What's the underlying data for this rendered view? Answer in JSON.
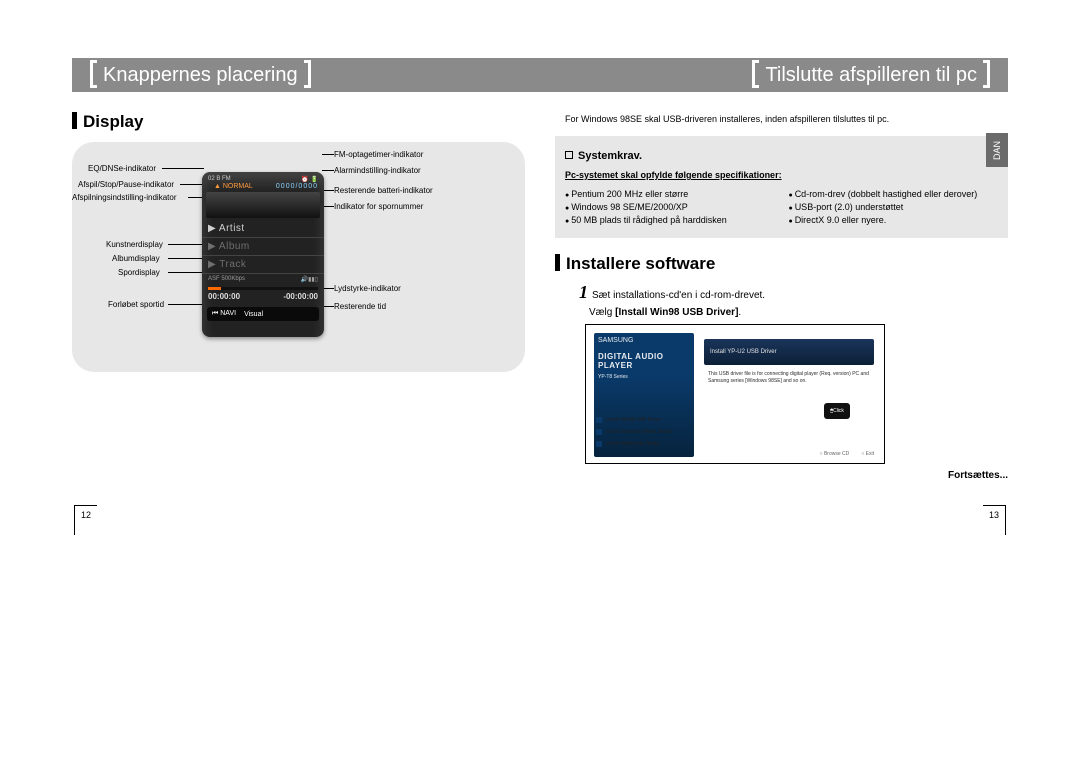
{
  "header": {
    "left_title": "Knappernes placering",
    "right_title": "Tilslutte afspilleren til pc"
  },
  "display": {
    "section_title": "Display",
    "labels": {
      "eq_dnse": "EQ/DNSe-indikator",
      "play_stop": "Afspil/Stop/Pause-indikator",
      "rec_setting": "Afspilningsindstilling-indikator",
      "artist": "Kunstnerdisplay",
      "album": "Albumdisplay",
      "track_disp": "Spordisplay",
      "elapsed": "Forløbet sportid",
      "fm_timer": "FM-optagetimer-indikator",
      "alarm": "Alarmindstilling-indikator",
      "battery": "Resterende batteri-indikator",
      "track_num": "Indikator for spornummer",
      "volume": "Lydstyrke-indikator",
      "remain": "Resterende tid"
    },
    "device": {
      "top_left": "02 B FM",
      "top_right": "⏰ 🔋",
      "mode": "▲ NORMAL",
      "counter": "0000/0000",
      "artist_row": "Artist",
      "album_row": "Album",
      "track_row": "Track",
      "codec": "ASF  500Kbps",
      "time_elapsed": "00:00:00",
      "time_remain": "-00:00:00",
      "navi": "⏮ NAVI",
      "visual": "Visual"
    }
  },
  "right": {
    "intro": "For Windows 98SE skal USB-driveren installeres, inden afspilleren tilsluttes til pc.",
    "systemkrav_title": "Systemkrav.",
    "spec_line": "Pc-systemet skal opfylde følgende specifikationer:",
    "specs_left": [
      "Pentium 200 MHz eller større",
      "Windows 98 SE/ME/2000/XP",
      "50 MB plads til rådighed på harddisken"
    ],
    "specs_right": [
      "Cd-rom-drev (dobbelt hastighed eller derover)",
      "USB-port (2.0) understøttet",
      "DirectX 9.0 eller nyere."
    ],
    "lang_tab": "DAN",
    "install_title": "Installere software",
    "step1_text": "Sæt installations-cd'en i cd-rom-drevet.",
    "step1_sub_pre": "Vælg ",
    "step1_sub_bold": "[Install Win98 USB Driver]",
    "step1_sub_post": ".",
    "installer": {
      "brand": "SAMSUNG",
      "big": "DIGITAL AUDIO PLAYER",
      "model": "YP-T8  Series",
      "menu_top": "Install YP-U2 USB Driver",
      "desc": "This USB driver file is for connecting digital player (Req. version) PC and Samsung series [Windows 98SE] and so on.",
      "click": "Click",
      "menu1": "Install Win98 USB Driver",
      "menu2": "Install Samsung Media Studio",
      "menu3": "Install Multimedia Studio",
      "foot1": "Browse CD",
      "foot2": "Exit"
    },
    "continued": "Fortsættes..."
  },
  "page_left": "12",
  "page_right": "13"
}
